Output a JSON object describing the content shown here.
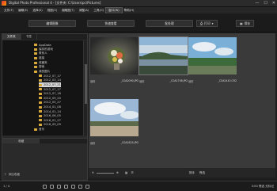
{
  "window": {
    "title": "Digital Photo Professional 4 - [文件夹: C:\\Users\\pc\\Pictures]",
    "minimize": "—",
    "maximize": "☐",
    "close": "✕"
  },
  "menu": [
    "文件(F)",
    "编辑(E)",
    "选择(S)",
    "视图(V)",
    "缩略图(T)",
    "调整(A)",
    "工具(O)",
    "窗口(W)",
    "帮助(H)"
  ],
  "modebar": {
    "edit_image_window": "编辑图像",
    "quick_check": "快速查看",
    "batch_process": "批处理",
    "print": "打印",
    "save": "保存"
  },
  "left_panel": {
    "tabs": [
      "文件夹",
      "书签"
    ],
    "tree": [
      {
        "label": "AppData",
        "indent": 1
      },
      {
        "label": "保存的游戏",
        "indent": 1
      },
      {
        "label": "联系人",
        "indent": 1
      },
      {
        "label": "链接",
        "indent": 1
      },
      {
        "label": "收藏夹",
        "indent": 1
      },
      {
        "label": "搜索",
        "indent": 1
      },
      {
        "label": "我的图片",
        "indent": 1
      },
      {
        "label": "2012_07_17",
        "indent": 2
      },
      {
        "label": "2012_03_14",
        "indent": 2
      },
      {
        "label": "2012_07_21",
        "indent": 2,
        "selected": true
      },
      {
        "label": "2012_07_17",
        "indent": 2
      },
      {
        "label": "2012_07_18",
        "indent": 2
      },
      {
        "label": "2012_09_20",
        "indent": 2
      },
      {
        "label": "2012_05_27",
        "indent": 2
      },
      {
        "label": "2014_01_08",
        "indent": 2
      },
      {
        "label": "2014_01_14",
        "indent": 2
      },
      {
        "label": "2016_06_05",
        "indent": 2
      },
      {
        "label": "2016_01_27",
        "indent": 2
      },
      {
        "label": "2016_09_09",
        "indent": 2
      },
      {
        "label": "音乐",
        "indent": 1
      }
    ],
    "favorites_tab": "收藏",
    "add_favorite": "添加收藏"
  },
  "thumbnails": [
    {
      "name": "_C0A2090.JPG",
      "tag": "编辑"
    },
    {
      "name": "_C0A1708.JPG",
      "tag": "编辑"
    },
    {
      "name": "_C0A2443.CR2",
      "tag": "编辑"
    },
    {
      "name": "_C0A1824.JPG",
      "tag": "编辑"
    }
  ],
  "bottom_toolbar": {
    "sort_label": "排序",
    "filter_label": "筛选"
  },
  "status": {
    "count": "1 / 4",
    "right_text": "3:00 筛选 无标记"
  }
}
